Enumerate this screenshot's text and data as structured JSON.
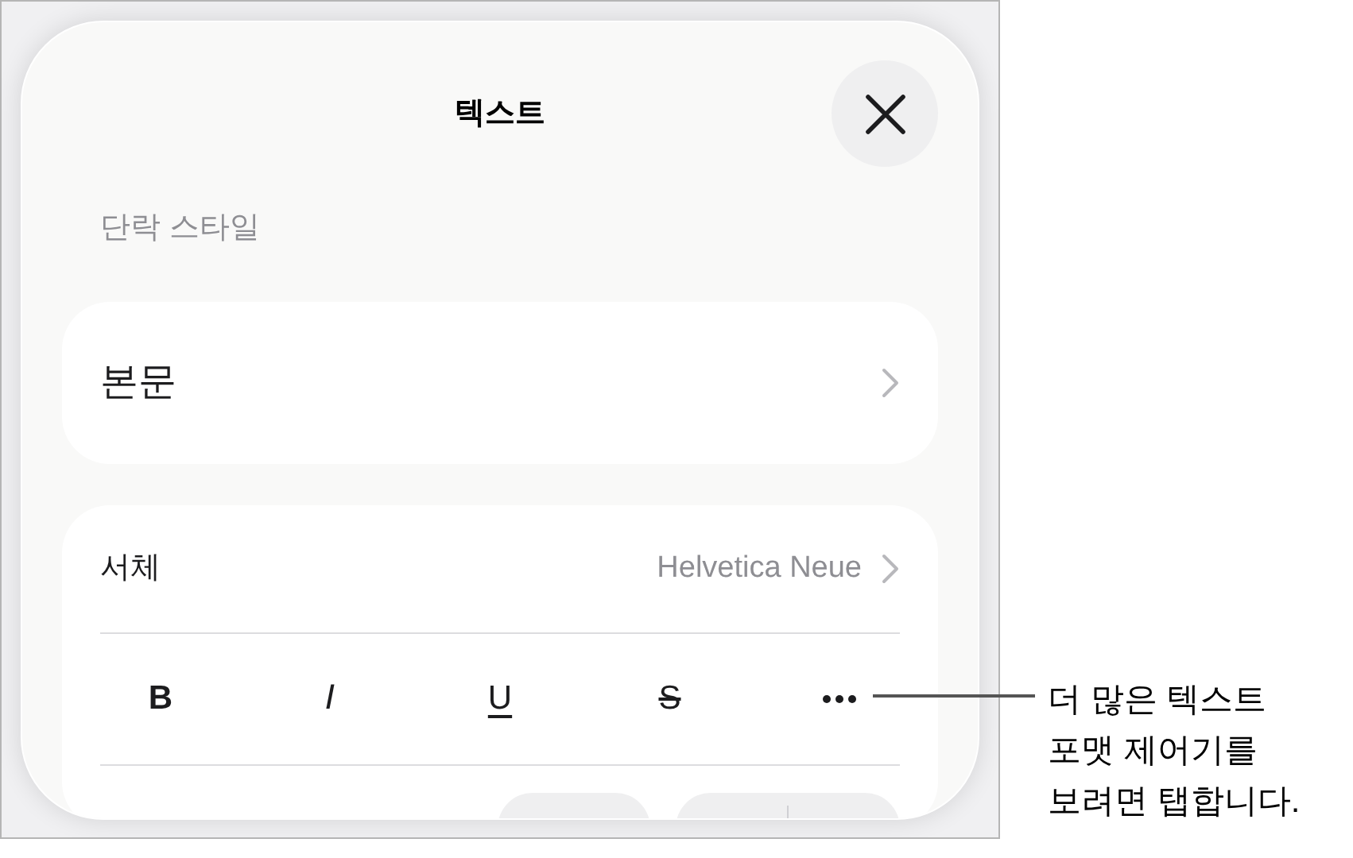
{
  "panel": {
    "title": "텍스트",
    "section_label": "단락 스타일",
    "paragraph_style": {
      "value": "본문"
    },
    "font": {
      "label": "서체",
      "value": "Helvetica Neue"
    },
    "format_buttons": [
      {
        "kind": "bold",
        "label": "B"
      },
      {
        "kind": "italic",
        "label": "I"
      },
      {
        "kind": "underline",
        "label": "U"
      },
      {
        "kind": "strikethrough",
        "label": "S"
      },
      {
        "kind": "more"
      }
    ]
  },
  "callout": {
    "lines": [
      "더 많은 텍스트",
      "포맷 제어기를",
      "보려면 탭합니다."
    ]
  }
}
